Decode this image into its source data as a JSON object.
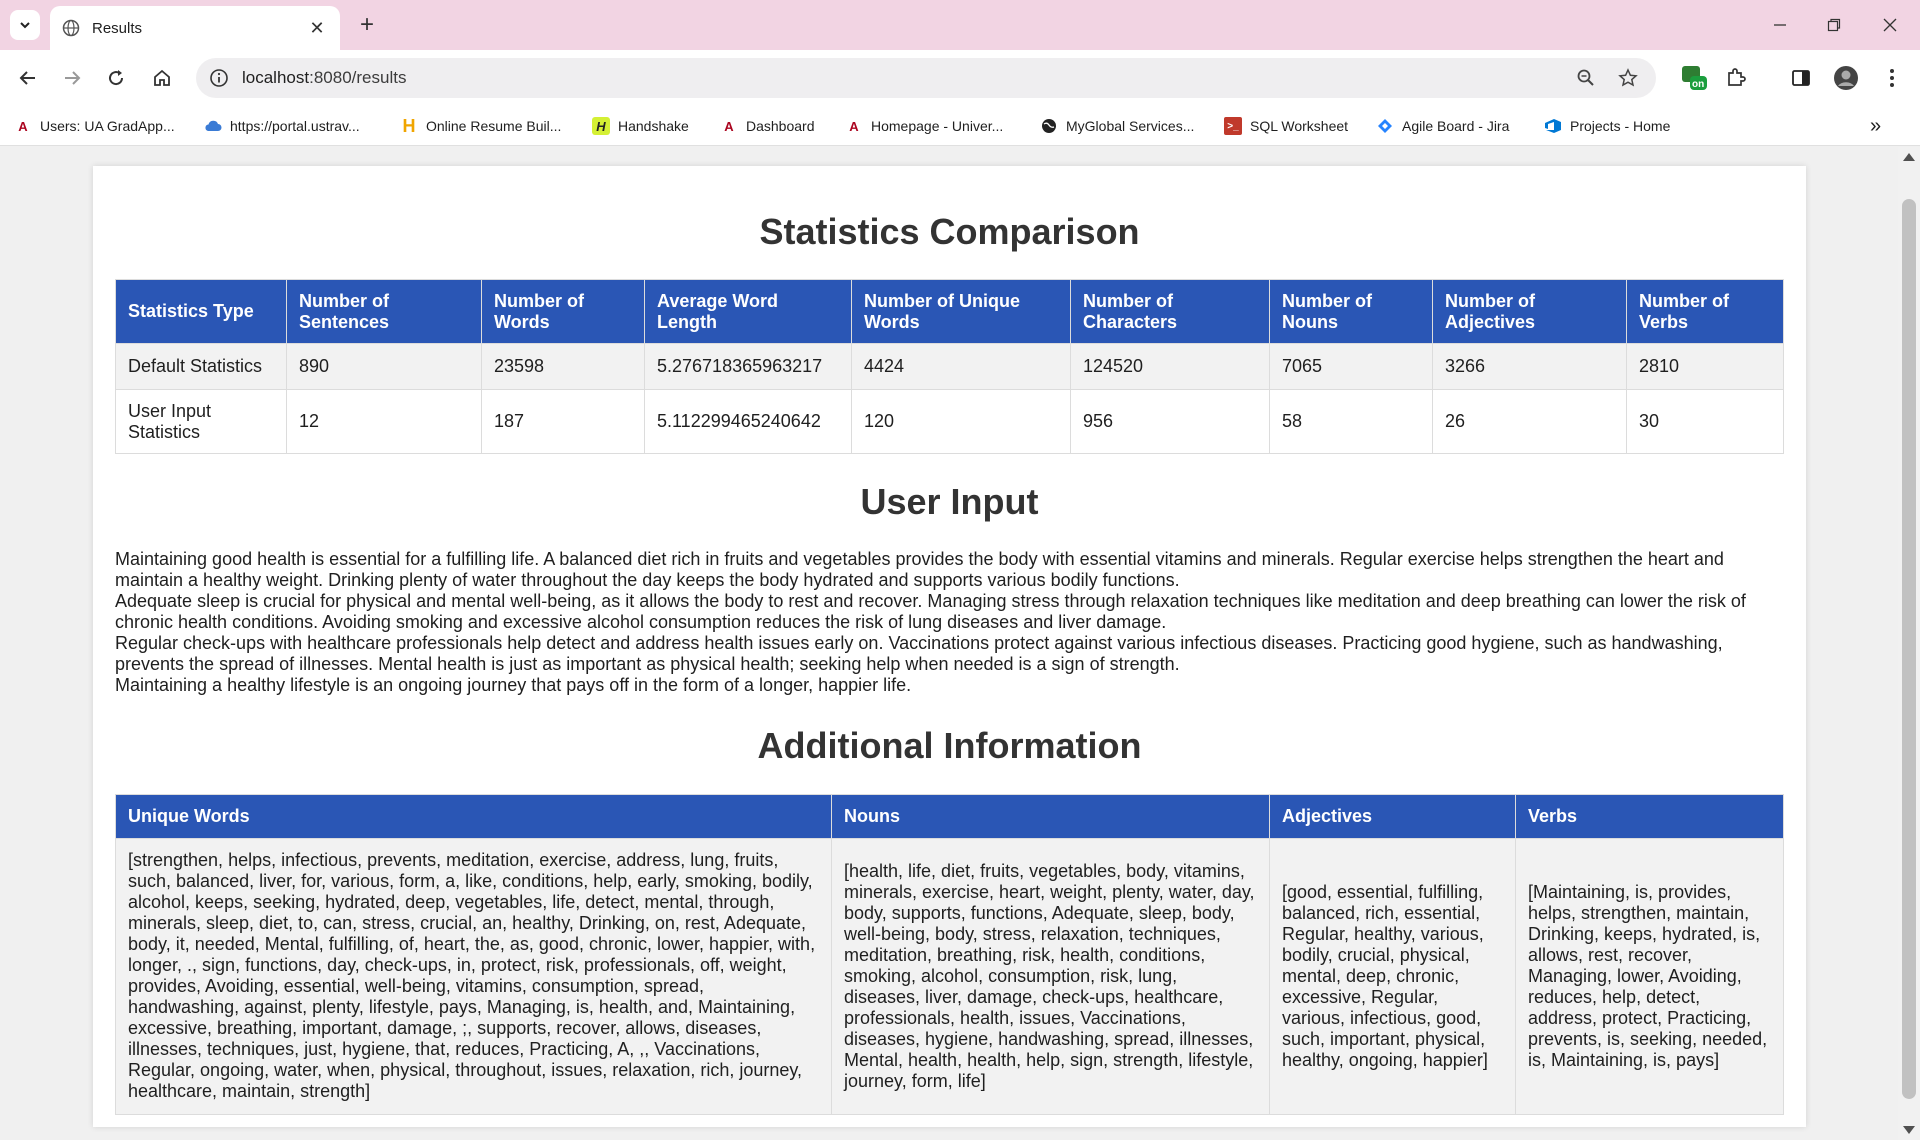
{
  "browser": {
    "tab_title": "Results",
    "url_host": "localhost",
    "url_rest": ":8080/results",
    "bookmarks": [
      {
        "label": "Users: UA GradApp...",
        "icon": "ua-logo-icon",
        "color": "#ab0520"
      },
      {
        "label": "https://portal.ustrav...",
        "icon": "cloud-icon",
        "color": "#3a7bd5"
      },
      {
        "label": "Online Resume Buil...",
        "icon": "h-logo-icon",
        "color": "#f0a500"
      },
      {
        "label": "Handshake",
        "icon": "handshake-icon",
        "color": "#d4f034"
      },
      {
        "label": "Dashboard",
        "icon": "ua-logo-icon",
        "color": "#ab0520"
      },
      {
        "label": "Homepage - Univer...",
        "icon": "ua-logo-icon",
        "color": "#ab0520"
      },
      {
        "label": "MyGlobal Services...",
        "icon": "globe-icon",
        "color": "#222222"
      },
      {
        "label": "SQL Worksheet",
        "icon": "terminal-icon",
        "color": "#c0392b"
      },
      {
        "label": "Agile Board - Jira",
        "icon": "jira-icon",
        "color": "#2684ff"
      },
      {
        "label": "Projects - Home",
        "icon": "devops-icon",
        "color": "#0078d4"
      }
    ]
  },
  "page": {
    "stats_title": "Statistics Comparison",
    "stats_headers": [
      "Statistics Type",
      "Number of Sentences",
      "Number of Words",
      "Average Word Length",
      "Number of Unique Words",
      "Number of Characters",
      "Number of Nouns",
      "Number of Adjectives",
      "Number of Verbs"
    ],
    "stats_rows": [
      [
        "Default Statistics",
        "890",
        "23598",
        "5.276718365963217",
        "4424",
        "124520",
        "7065",
        "3266",
        "2810"
      ],
      [
        "User Input Statistics",
        "12",
        "187",
        "5.112299465240642",
        "120",
        "956",
        "58",
        "26",
        "30"
      ]
    ],
    "input_title": "User Input",
    "input_paragraphs": [
      "Maintaining good health is essential for a fulfilling life. A balanced diet rich in fruits and vegetables provides the body with essential vitamins and minerals. Regular exercise helps strengthen the heart and maintain a healthy weight. Drinking plenty of water throughout the day keeps the body hydrated and supports various bodily functions.",
      "Adequate sleep is crucial for physical and mental well-being, as it allows the body to rest and recover. Managing stress through relaxation techniques like meditation and deep breathing can lower the risk of chronic health conditions. Avoiding smoking and excessive alcohol consumption reduces the risk of lung diseases and liver damage.",
      "Regular check-ups with healthcare professionals help detect and address health issues early on. Vaccinations protect against various infectious diseases. Practicing good hygiene, such as handwashing, prevents the spread of illnesses. Mental health is just as important as physical health; seeking help when needed is a sign of strength.",
      "Maintaining a healthy lifestyle is an ongoing journey that pays off in the form of a longer, happier life."
    ],
    "additional_title": "Additional Information",
    "additional_headers": [
      "Unique Words",
      "Nouns",
      "Adjectives",
      "Verbs"
    ],
    "additional_values": [
      "[strengthen, helps, infectious, prevents, meditation, exercise, address, lung, fruits, such, balanced, liver, for, various, form, a, like, conditions, help, early, smoking, bodily, alcohol, keeps, seeking, hydrated, deep, vegetables, life, detect, mental, through, minerals, sleep, diet, to, can, stress, crucial, an, healthy, Drinking, on, rest, Adequate, body, it, needed, Mental, fulfilling, of, heart, the, as, good, chronic, lower, happier, with, longer, ., sign, functions, day, check-ups, in, protect, risk, professionals, off, weight, provides, Avoiding, essential, well-being, vitamins, consumption, spread, handwashing, against, plenty, lifestyle, pays, Managing, is, health, and, Maintaining, excessive, breathing, important, damage, ;, supports, recover, allows, diseases, illnesses, techniques, just, hygiene, that, reduces, Practicing, A, ,, Vaccinations, Regular, ongoing, water, when, physical, throughout, issues, relaxation, rich, journey, healthcare, maintain, strength]",
      "[health, life, diet, fruits, vegetables, body, vitamins, minerals, exercise, heart, weight, plenty, water, day, body, supports, functions, Adequate, sleep, body, well-being, body, stress, relaxation, techniques, meditation, breathing, risk, health, conditions, smoking, alcohol, consumption, risk, lung, diseases, liver, damage, check-ups, healthcare, professionals, health, issues, Vaccinations, diseases, hygiene, handwashing, spread, illnesses, Mental, health, health, help, sign, strength, lifestyle, journey, form, life]",
      "[good, essential, fulfilling, balanced, rich, essential, Regular, healthy, various, bodily, crucial, physical, mental, deep, chronic, excessive, Regular, various, infectious, good, such, important, physical, healthy, ongoing, happier]",
      "[Maintaining, is, provides, helps, strengthen, maintain, Drinking, keeps, hydrated, is, allows, rest, recover, Managing, lower, Avoiding, reduces, help, detect, address, protect, Practicing, prevents, is, seeking, needed, is, Maintaining, is, pays]"
    ],
    "header_color": "#2a56b5"
  }
}
